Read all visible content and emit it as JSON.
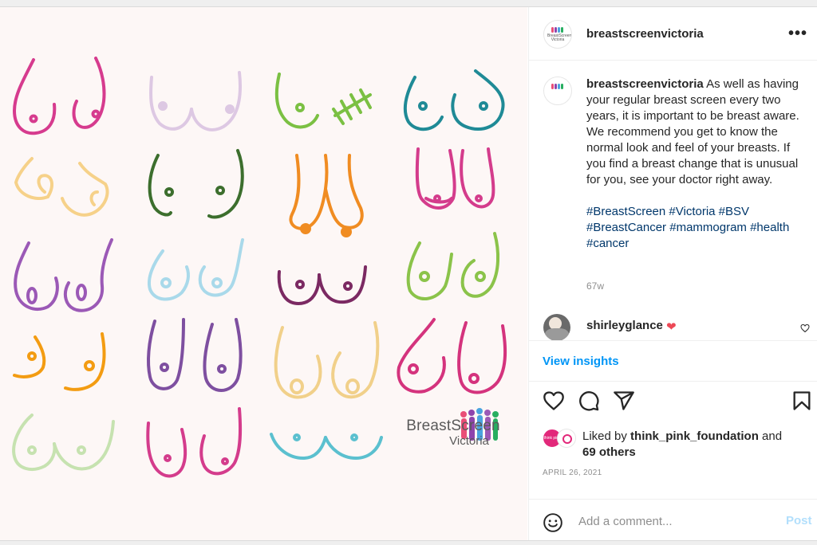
{
  "post": {
    "username": "breastscreenvictoria",
    "avatar_brand": "BreastScreen Victoria",
    "more_icon": "more-horizontal-icon"
  },
  "image": {
    "brand_name": "BreastScreen",
    "brand_sub": "Victoria",
    "background": "#fdf7f6",
    "palette": [
      "#d63b8e",
      "#ddc8e3",
      "#7bc043",
      "#1f8a96",
      "#f6d189",
      "#3c6e2d",
      "#f08c22",
      "#d43c8c",
      "#9b59b6",
      "#a9d9ea",
      "#7b2962",
      "#8bc34a",
      "#f39c12",
      "#7e4fa0",
      "#f1d08a",
      "#d4337d",
      "#c6e2b0",
      "#d43c8c",
      "#5bc0cf"
    ]
  },
  "caption": {
    "username": "breastscreenvictoria",
    "text": "As well as having your regular breast screen every two years, it is important to be breast aware. We recommend you get to know the normal look and feel of your breasts. If you find a breast change that is unusual for you, see your doctor right away.",
    "hashtags": [
      "#BreastScreen",
      "#Victoria",
      "#BSV",
      "#BreastCancer",
      "#mammogram",
      "#health",
      "#cancer"
    ],
    "time": "67w"
  },
  "comment": {
    "username": "shirleyglance",
    "emoji": "❤"
  },
  "insights_label": "View insights",
  "actions": {
    "like_icon": "heart-icon",
    "comment_icon": "comment-icon",
    "share_icon": "paper-plane-icon",
    "save_icon": "bookmark-icon"
  },
  "likes": {
    "prefix": "Liked by",
    "user": "think_pink_foundation",
    "and": "and",
    "others": "69 others",
    "avatar_label": "think pink"
  },
  "date": "APRIL 26, 2021",
  "add_comment": {
    "placeholder": "Add a comment...",
    "post_label": "Post"
  }
}
